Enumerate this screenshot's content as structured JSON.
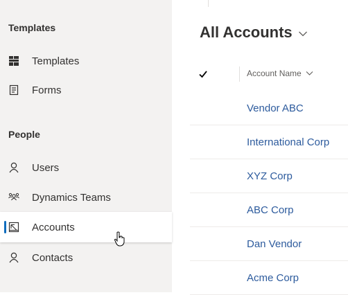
{
  "sidebar": {
    "sections": [
      {
        "title": "Templates",
        "items": [
          {
            "label": "Templates",
            "icon": "templates-icon"
          },
          {
            "label": "Forms",
            "icon": "forms-icon"
          }
        ]
      },
      {
        "title": "People",
        "items": [
          {
            "label": "Users",
            "icon": "user-icon"
          },
          {
            "label": "Dynamics Teams",
            "icon": "teams-icon"
          },
          {
            "label": "Accounts",
            "icon": "accounts-icon",
            "selected": true
          },
          {
            "label": "Contacts",
            "icon": "user-icon"
          }
        ]
      }
    ]
  },
  "main": {
    "view_title": "All Accounts",
    "view_selector_icon": "chevron-down-icon",
    "table": {
      "select_all_icon": "checkmark-icon",
      "column_header": "Account Name",
      "sort_icon": "chevron-down-icon",
      "rows": [
        "Vendor ABC",
        "International Corp",
        "XYZ Corp",
        "ABC Corp",
        "Dan Vendor",
        "Acme Corp"
      ]
    }
  },
  "colors": {
    "sidebar_bg": "#f3f2f1",
    "selected_indicator": "#0f6cbd",
    "link_text": "#2d5b9d"
  }
}
